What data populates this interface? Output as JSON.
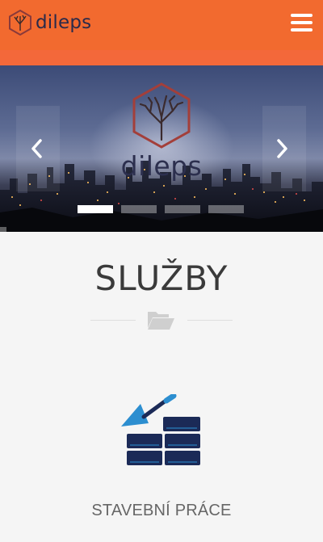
{
  "header": {
    "logo_text": "dileps",
    "menu_icon": "hamburger-menu-icon",
    "background": "#f26a2f"
  },
  "hero": {
    "logo_text": "dileps",
    "prev_icon": "chevron-left-icon",
    "next_icon": "chevron-right-icon",
    "slides_count": 4,
    "active_slide": 1
  },
  "section": {
    "title": "SLUŽBY",
    "divider_icon": "folder-open-icon"
  },
  "services": [
    {
      "label": "STAVEBNÍ PRÁCE",
      "icon": "bricks-trowel-icon"
    }
  ],
  "colors": {
    "accent": "#f26a2f",
    "brand_dark": "#2a2a4a",
    "icon_blue": "#2c8ed0",
    "brick_navy": "#1b2a57"
  }
}
